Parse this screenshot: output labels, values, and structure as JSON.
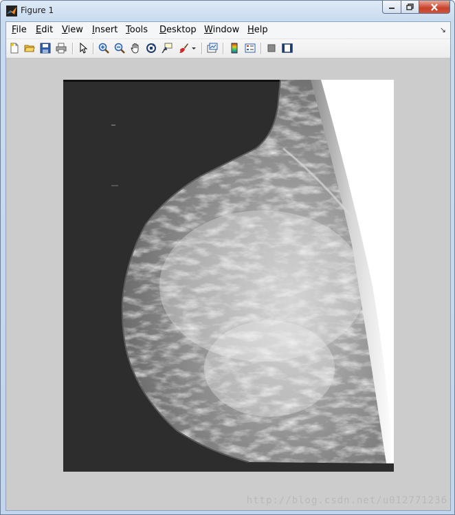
{
  "window": {
    "title": "Figure 1"
  },
  "menubar": {
    "items": [
      {
        "label": "File",
        "accel": "F",
        "rest": "ile"
      },
      {
        "label": "Edit",
        "accel": "E",
        "rest": "dit"
      },
      {
        "label": "View",
        "accel": "V",
        "rest": "iew"
      },
      {
        "label": "Insert",
        "accel": "I",
        "rest": "nsert"
      },
      {
        "label": "Tools",
        "accel": "T",
        "rest": "ools"
      },
      {
        "label": "Desktop",
        "accel": "D",
        "rest": "esktop"
      },
      {
        "label": "Window",
        "accel": "W",
        "rest": "indow"
      },
      {
        "label": "Help",
        "accel": "H",
        "rest": "elp"
      }
    ],
    "dock_arrow": "↘"
  },
  "toolbar": {
    "buttons": [
      "new-figure-icon",
      "open-file-icon",
      "save-icon",
      "print-icon",
      "edit-plot-arrow-icon",
      "zoom-in-icon",
      "zoom-out-icon",
      "pan-hand-icon",
      "rotate-3d-icon",
      "data-cursor-icon",
      "brush-icon",
      "brush-dropdown-icon",
      "link-plot-icon",
      "colorbar-icon",
      "legend-icon",
      "hide-plot-tools-icon",
      "show-plot-tools-icon"
    ]
  },
  "figure": {
    "image_alt": "grayscale mammogram image",
    "background_color": "#cccccc",
    "image_background": "#2d2d2d"
  },
  "watermark": "http://blog.csdn.net/u012771236"
}
